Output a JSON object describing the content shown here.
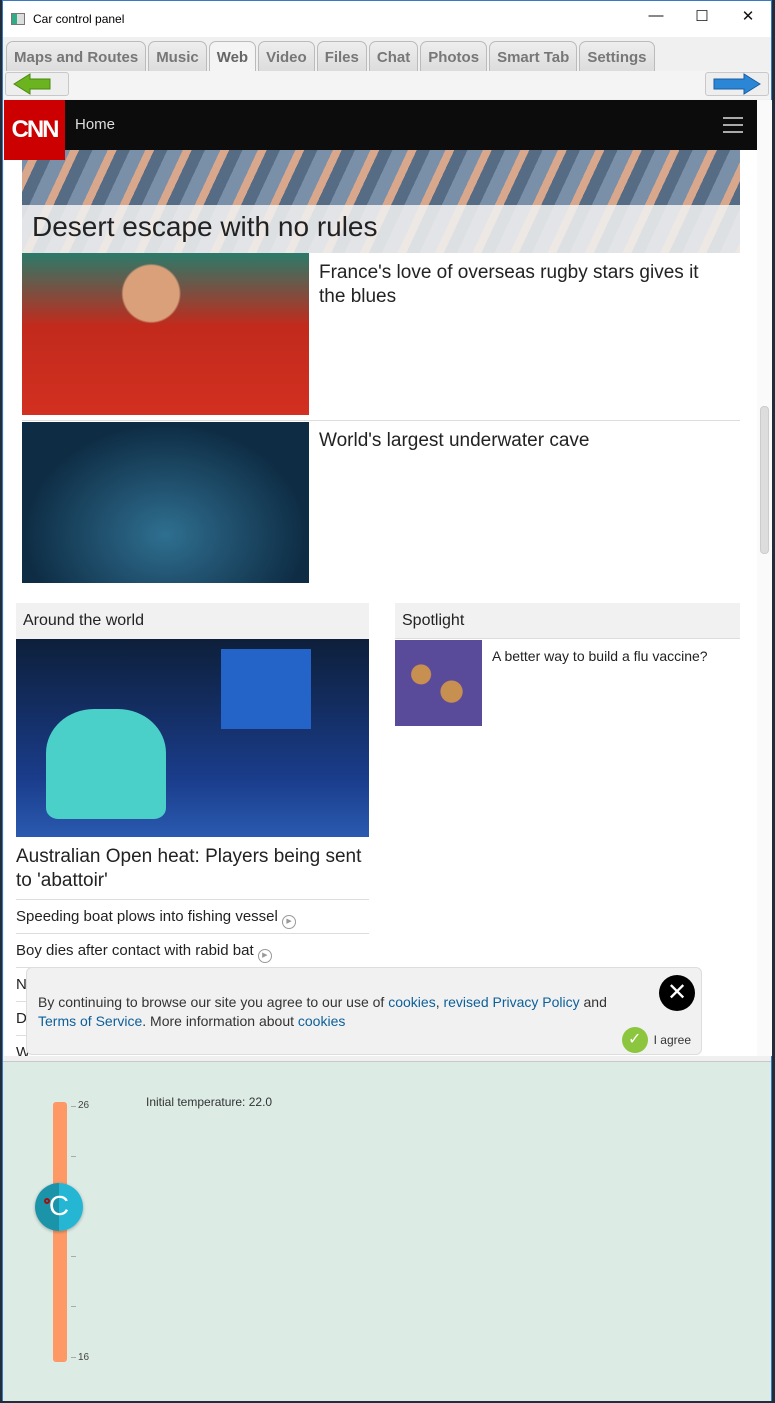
{
  "window": {
    "title": "Car control panel",
    "minimize": "—",
    "maximize": "☐",
    "close": "✕"
  },
  "tabs": [
    {
      "label": "Maps and Routes"
    },
    {
      "label": "Music"
    },
    {
      "label": "Web",
      "active": true
    },
    {
      "label": "Video"
    },
    {
      "label": "Files"
    },
    {
      "label": "Chat"
    },
    {
      "label": "Photos"
    },
    {
      "label": "Smart Tab"
    },
    {
      "label": "Settings"
    }
  ],
  "nav": {
    "back_icon": "green-left-arrow",
    "forward_icon": "blue-right-arrow"
  },
  "web": {
    "logo": "CNN",
    "home": "Home",
    "hero": "Desert escape with no rules",
    "stories": [
      "France's love of overseas rugby stars gives it the blues",
      "World's largest underwater cave"
    ],
    "around": {
      "title": "Around the world",
      "headline": "Australian Open heat: Players being sent to 'abattoir'",
      "links": [
        "Speeding boat plows into fishing vessel",
        "Boy dies after contact with rabid bat",
        "N",
        "D",
        "W"
      ]
    },
    "spotlight": {
      "title": "Spotlight",
      "item": "A better way to build a flu vaccine?"
    },
    "cookie": {
      "t1": "By continuing to browse our site you agree to our use of ",
      "l1": "cookies",
      "t2": ", ",
      "l2": "revised Privacy Policy",
      "t3": " and ",
      "l3": "Terms of Service",
      "t4": ". More information about ",
      "l4": "cookies",
      "close": "✕",
      "agree": "I agree"
    }
  },
  "climate": {
    "label": "Initial temperature: 22.0",
    "max_label": "26",
    "min_label": "16",
    "min": 16,
    "max": 26,
    "value": 22.0,
    "knob_text": "C",
    "track_color": "#fe9966",
    "knob_color": "#25b6d3"
  }
}
